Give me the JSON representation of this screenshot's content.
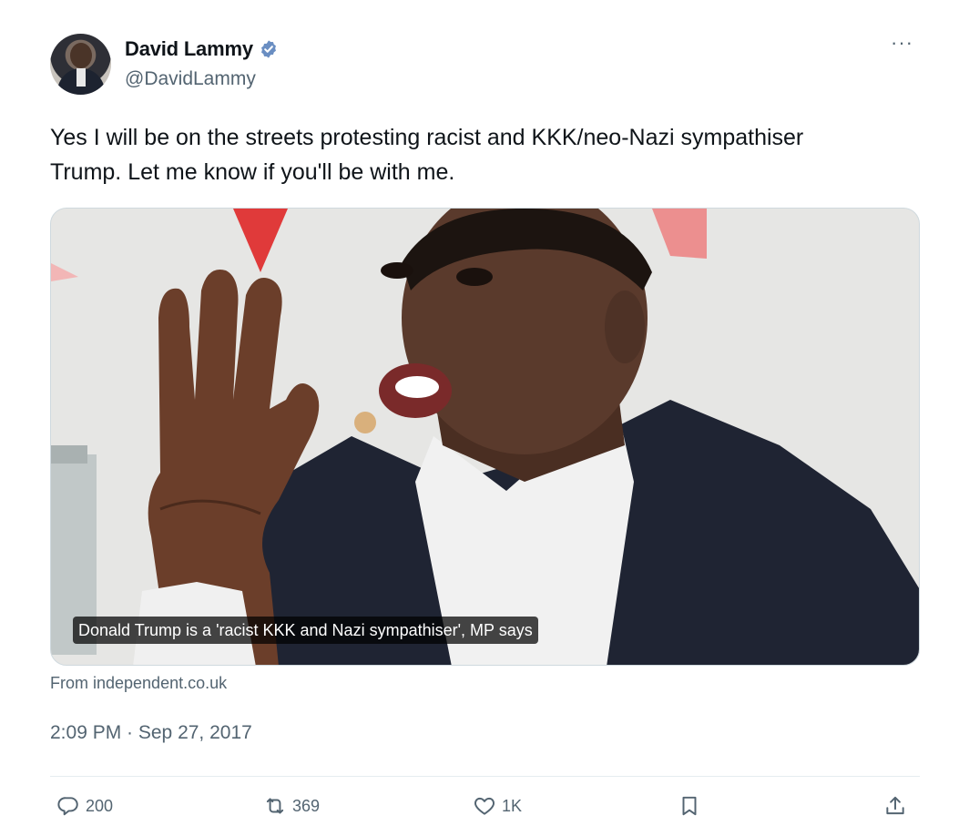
{
  "author": {
    "display_name": "David Lammy",
    "handle": "@DavidLammy",
    "verified": true,
    "verified_color": "#6a8ec2"
  },
  "tweet": {
    "text": "Yes I will be on the streets protesting racist and KKK/neo-Nazi sympathiser Trump. Let me know if you'll be with me."
  },
  "link_card": {
    "caption": "Donald Trump is a 'racist KKK and Nazi sympathiser', MP says",
    "source": "From independent.co.uk"
  },
  "timestamp": "2:09 PM · Sep 27, 2017",
  "actions": {
    "replies": "200",
    "reposts": "369",
    "likes": "1K"
  },
  "icons": {
    "more": "more-horizontal-icon",
    "reply": "reply-icon",
    "repost": "repost-icon",
    "like": "heart-icon",
    "bookmark": "bookmark-icon",
    "share": "share-icon"
  }
}
